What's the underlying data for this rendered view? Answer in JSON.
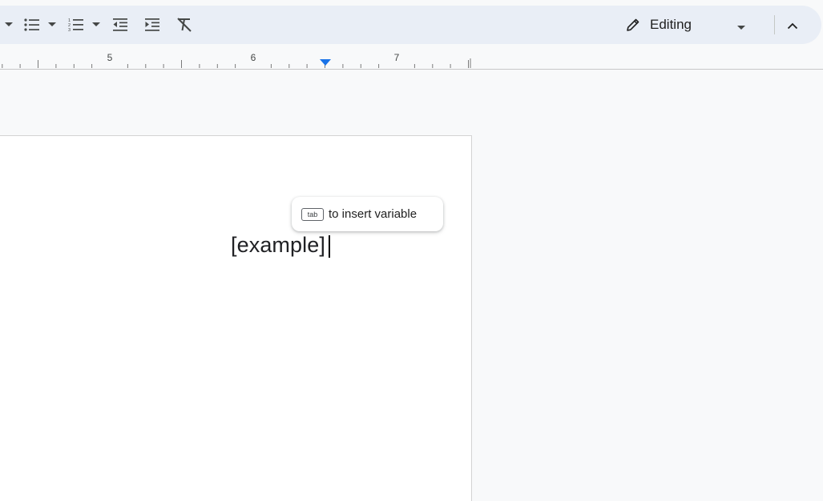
{
  "toolbar": {
    "editing_mode_label": "Editing",
    "icons": [
      "caret-down-icon",
      "bulleted-list-icon",
      "numbered-list-icon",
      "decrease-indent-icon",
      "increase-indent-icon",
      "clear-formatting-icon",
      "pencil-icon",
      "chevron-up-icon"
    ]
  },
  "ruler": {
    "numbers": [
      "5",
      "6",
      "7"
    ]
  },
  "document": {
    "text": "[example]"
  },
  "variable_hint": {
    "key": "tab",
    "text": "to insert variable"
  },
  "colors": {
    "toolbar_bg": "#e9eef6",
    "canvas_bg": "#f8f9fa",
    "indent_marker": "#1a73e8"
  }
}
